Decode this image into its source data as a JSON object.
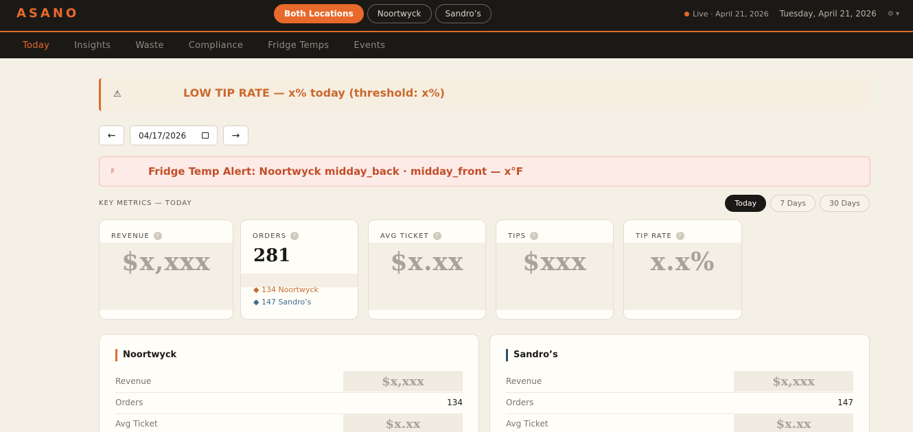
{
  "brand": "ASANO",
  "locations": [
    {
      "label": "Both Locations",
      "active": true
    },
    {
      "label": "Noortwyck",
      "active": false
    },
    {
      "label": "Sandro’s",
      "active": false
    }
  ],
  "status": {
    "live": "Live · April 21, 2026",
    "date": "Tuesday, April 21, 2026",
    "settings": "⚙ ▾"
  },
  "nav": [
    {
      "label": "Today",
      "active": true
    },
    {
      "label": "Insights",
      "active": false
    },
    {
      "label": "Waste",
      "active": false
    },
    {
      "label": "Compliance",
      "active": false
    },
    {
      "label": "Fridge Temps",
      "active": false
    },
    {
      "label": "Events",
      "active": false
    }
  ],
  "alert_tip": {
    "icon": "⚠",
    "text": "LOW TIP RATE — x% today (threshold: x%)"
  },
  "date_picker": {
    "prev": "←",
    "value": "04/17/2026",
    "next": "→"
  },
  "alert_fridge": {
    "icon": "🌡",
    "text": "Fridge Temp Alert: Noortwyck midday_back · midday_front — x°F"
  },
  "key_metrics": {
    "label": "KEY METRICS — TODAY",
    "ranges": [
      {
        "label": "Today",
        "active": true
      },
      {
        "label": "7 Days",
        "active": false
      },
      {
        "label": "30 Days",
        "active": false
      }
    ],
    "help": "?",
    "cards": {
      "revenue": {
        "title": "REVENUE",
        "value": "$x,xxx"
      },
      "orders": {
        "title": "ORDERS",
        "value": "281",
        "noortwyck": "◆ 134 Noortwyck",
        "sandros": "◆ 147 Sandro’s"
      },
      "avg_ticket": {
        "title": "AVG TICKET",
        "value": "$x.xx"
      },
      "tips": {
        "title": "TIPS",
        "value": "$xxx"
      },
      "tip_rate": {
        "title": "TIP RATE",
        "value": "x.x%"
      }
    }
  },
  "locations_detail": {
    "noortwyck": {
      "name": "Noortwyck",
      "revenue_label": "Revenue",
      "revenue": "$x,xxx",
      "orders_label": "Orders",
      "orders": "134",
      "avg_label": "Avg Ticket",
      "avg": "$x.xx"
    },
    "sandros": {
      "name": "Sandro’s",
      "revenue_label": "Revenue",
      "revenue": "$x,xxx",
      "orders_label": "Orders",
      "orders": "147",
      "avg_label": "Avg Ticket",
      "avg": "$x.xx"
    }
  },
  "colors": {
    "accent": "#e8692c",
    "dark": "#1b1916",
    "sandros": "#2f4d6a",
    "background": "#f4f0e6"
  }
}
